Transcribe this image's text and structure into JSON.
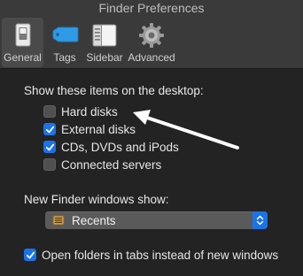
{
  "window": {
    "title": "Finder Preferences"
  },
  "toolbar": {
    "tabs": [
      {
        "label": "General",
        "icon": "general-switch-icon",
        "selected": true
      },
      {
        "label": "Tags",
        "icon": "tag-icon",
        "selected": false
      },
      {
        "label": "Sidebar",
        "icon": "sidebar-icon",
        "selected": false
      },
      {
        "label": "Advanced",
        "icon": "gear-icon",
        "selected": false
      }
    ]
  },
  "desktop_section": {
    "label": "Show these items on the desktop:",
    "items": [
      {
        "label": "Hard disks",
        "checked": false
      },
      {
        "label": "External disks",
        "checked": true
      },
      {
        "label": "CDs, DVDs and iPods",
        "checked": true
      },
      {
        "label": "Connected servers",
        "checked": false
      }
    ]
  },
  "new_window_section": {
    "label": "New Finder windows show:",
    "selected_value": "Recents",
    "selected_icon": "recents-icon"
  },
  "tabs_option": {
    "label": "Open folders in tabs instead of new windows",
    "checked": true
  },
  "colors": {
    "accent": "#1a73e8",
    "background": "#232323",
    "toolbar": "#3a3a3a",
    "tag_blue": "#2f9be6"
  }
}
